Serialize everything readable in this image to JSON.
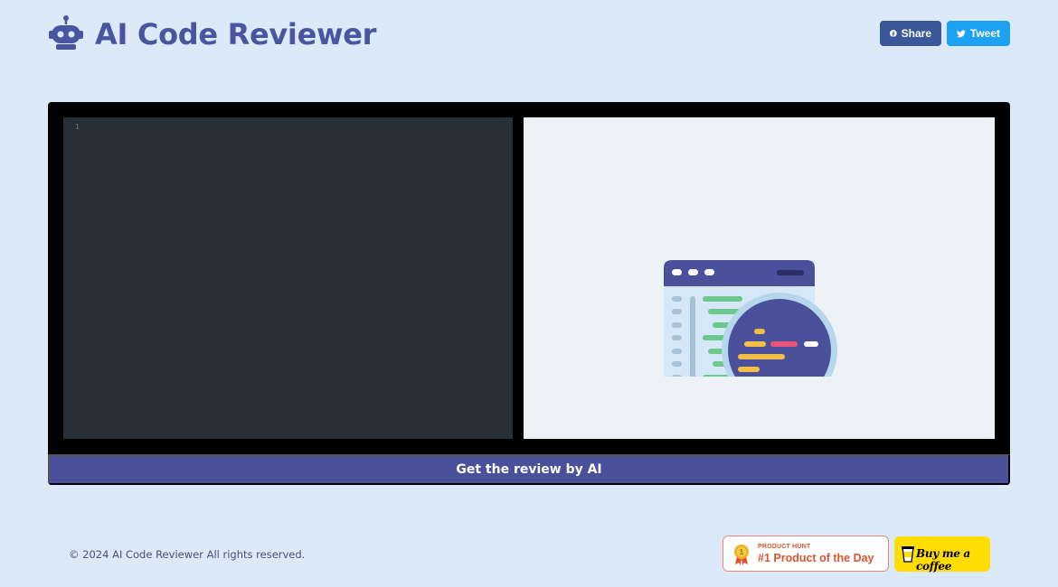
{
  "header": {
    "title": "AI Code Reviewer",
    "logo_icon": "robot-icon",
    "share_label": "Share",
    "tweet_label": "Tweet"
  },
  "editor": {
    "line_numbers": [
      "1"
    ]
  },
  "preview": {
    "illustration_icon": "code-magnifier-icon"
  },
  "actions": {
    "review_label": "Get the review by AI"
  },
  "footer": {
    "copyright": "© 2024 AI Code Reviewer All rights reserved.",
    "product_hunt": {
      "small_label": "PRODUCT HUNT",
      "big_label": "#1 Product of the Day"
    },
    "coffee_label": "Buy me a coffee"
  },
  "colors": {
    "background": "#dce9f8",
    "brand": "#4a55a0",
    "facebook": "#3b5998",
    "twitter": "#1da1f2",
    "review_button": "#4a519a",
    "editor_bg": "#282f37",
    "product_hunt": "#da552f",
    "coffee": "#ffdd00"
  }
}
